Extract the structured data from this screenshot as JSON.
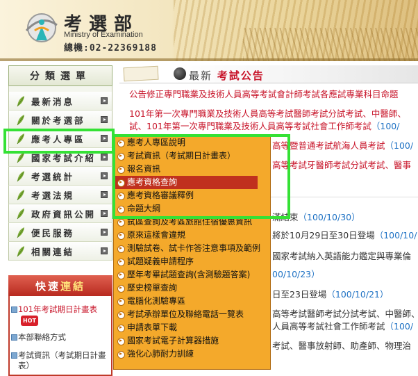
{
  "header": {
    "title": "考選部",
    "subtitle": "Ministry of Examination",
    "phone": "總機:02-22369188"
  },
  "sidebar": {
    "heading": "分類選單",
    "items": [
      {
        "label": "最新消息"
      },
      {
        "label": "關於考選部"
      },
      {
        "label": "應考人專區"
      },
      {
        "label": "國家考試介紹"
      },
      {
        "label": "考選統計"
      },
      {
        "label": "考選法規"
      },
      {
        "label": "政府資訊公開"
      },
      {
        "label": "便民服務"
      },
      {
        "label": "相關連結"
      }
    ]
  },
  "quick_links": {
    "heading_a": "快速",
    "heading_b": "連結",
    "items": [
      {
        "label": "101年考試期日計畫表",
        "badge": "HOT"
      },
      {
        "label": "本部聯絡方式"
      },
      {
        "label": "考試資訊（考試期日計畫表）"
      }
    ]
  },
  "main": {
    "heading_prefix": "最新",
    "heading_title": "考試公告",
    "news": [
      {
        "text": "公告修正專門職業及技術人員高等考試會計師考試各應試專業科目命題"
      },
      {
        "text": "101年第一次專門職業及技術人員高等考試醫師考試分試考試、中醫師、"
      },
      {
        "text": "試、101年第一次專門職業及技術人員高等考試社會工作師考試",
        "date": "（100/"
      },
      {
        "text": "高等暨普通考試航海人員考試",
        "date": "（100/"
      },
      {
        "text": "高等考試牙醫師考試分試考試、醫事"
      },
      {
        "text": "滿結束",
        "date": "（100/10/30）"
      },
      {
        "text": "將於10月29日至30日登場",
        "date": "（100/10/"
      },
      {
        "text": "國家考試納入英語能力鑑定與專業倫"
      },
      {
        "text": "",
        "date": "00/10/23）"
      },
      {
        "text": "日至23日登場",
        "date": "（100/10/21）"
      },
      {
        "text": "高等考試醫師考試分試考試、中醫師、"
      },
      {
        "text": "人員高等考試社會工作師考試",
        "date": "（100/"
      },
      {
        "text": "考試、醫事放射師、助產師、物理治"
      }
    ]
  },
  "dropdown": {
    "items": [
      {
        "label": "應考人專區說明"
      },
      {
        "label": "考試資訊（考試期日計畫表）"
      },
      {
        "label": "報名資訊"
      },
      {
        "label": "應考資格查詢",
        "active": true
      },
      {
        "label": "應考資格審議釋例"
      },
      {
        "label": "命題大綱"
      },
      {
        "label": "試區查詢及考區旅館住宿優惠資訊"
      },
      {
        "label": "原來這樣會違規"
      },
      {
        "label": "測驗試卷、試卡作答注意事項及範例"
      },
      {
        "label": "試題疑義申請程序"
      },
      {
        "label": "歷年考畢試題查詢(含測驗題答案)"
      },
      {
        "label": "歷史榜單查詢"
      },
      {
        "label": "電腦化測驗專區"
      },
      {
        "label": "考試承辦單位及聯絡電話一覽表"
      },
      {
        "label": "申請表單下載"
      },
      {
        "label": "國家考試電子計算器措施"
      },
      {
        "label": "強化心肺耐力訓練"
      }
    ]
  },
  "colors": {
    "accent_red": "#c8152a",
    "menu_orange": "#f4a92b",
    "highlight_green": "#35e135",
    "date_blue": "#1f72c4"
  }
}
